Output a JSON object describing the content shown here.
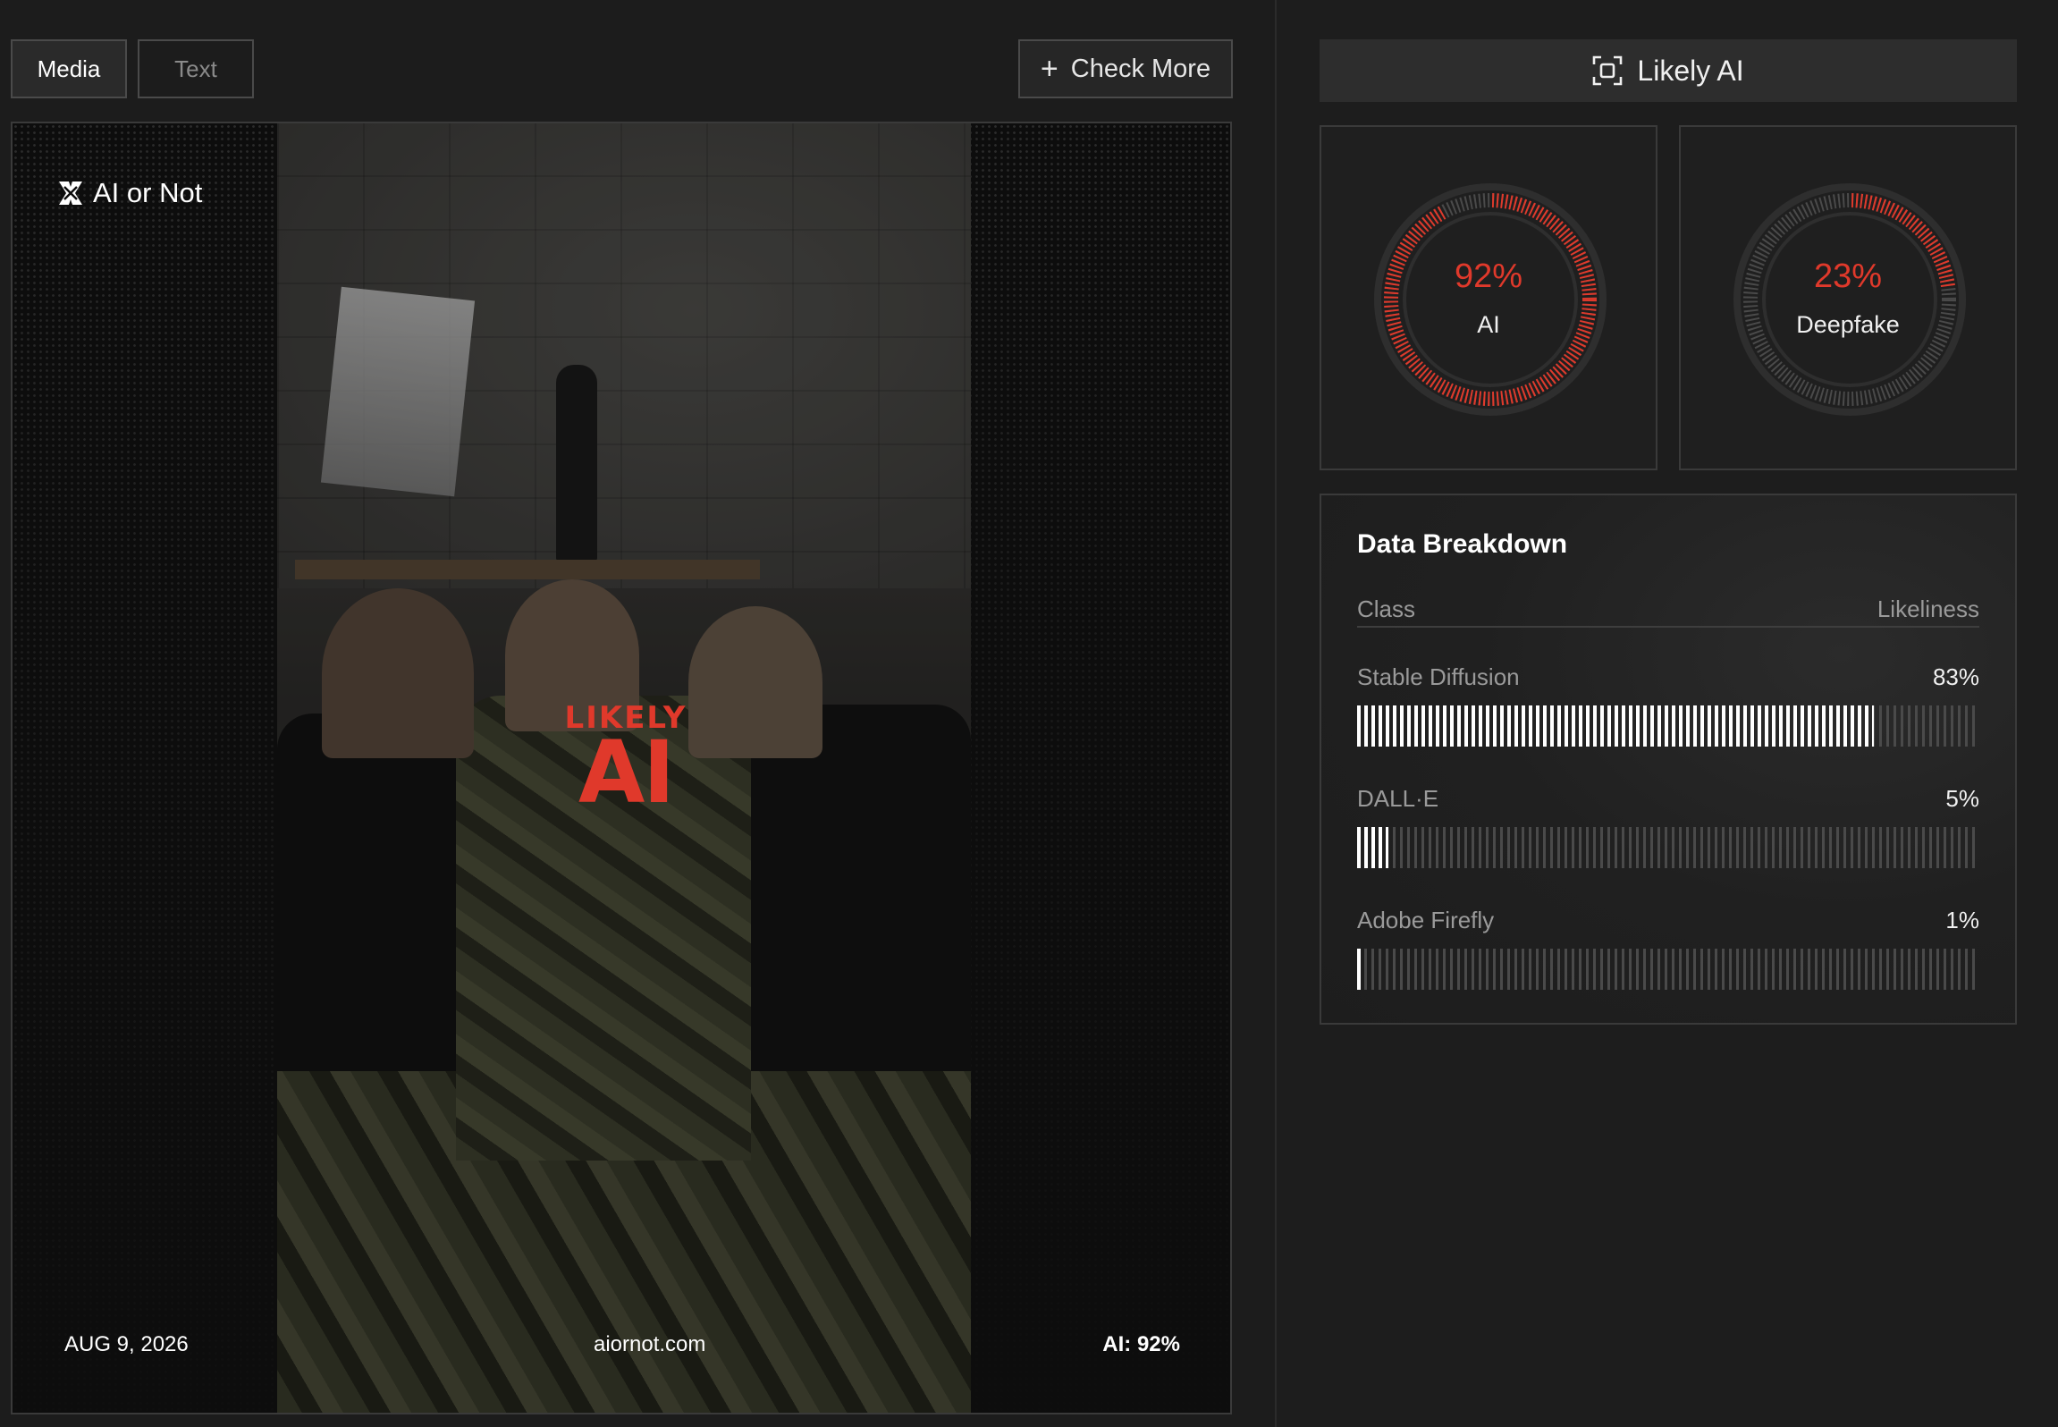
{
  "tabs": {
    "media": "Media",
    "text": "Text"
  },
  "actions": {
    "check_more": "Check More"
  },
  "preview": {
    "brand": "AI or Not",
    "stamp_top": "LIKELY",
    "stamp_main": "AI",
    "date": "AUG 9, 2026",
    "site": "aiornot.com",
    "ai_score": "AI: 92%"
  },
  "verdict": {
    "label": "Likely AI"
  },
  "gauges": [
    {
      "value": "92%",
      "label": "AI",
      "fraction": 0.92,
      "color": "#e0392b"
    },
    {
      "value": "23%",
      "label": "Deepfake",
      "fraction": 0.23,
      "color": "#e0392b"
    }
  ],
  "breakdown": {
    "title": "Data Breakdown",
    "col_class": "Class",
    "col_likeliness": "Likeliness",
    "rows": [
      {
        "class": "Stable Diffusion",
        "pct": "83%",
        "fraction": 0.83
      },
      {
        "class": "DALL·E",
        "pct": "5%",
        "fraction": 0.05
      },
      {
        "class": "Adobe Firefly",
        "pct": "1%",
        "fraction": 0.01
      }
    ]
  },
  "colors": {
    "accent": "#e0392b",
    "background": "#1c1c1c",
    "panel": "#2d2d2d"
  }
}
